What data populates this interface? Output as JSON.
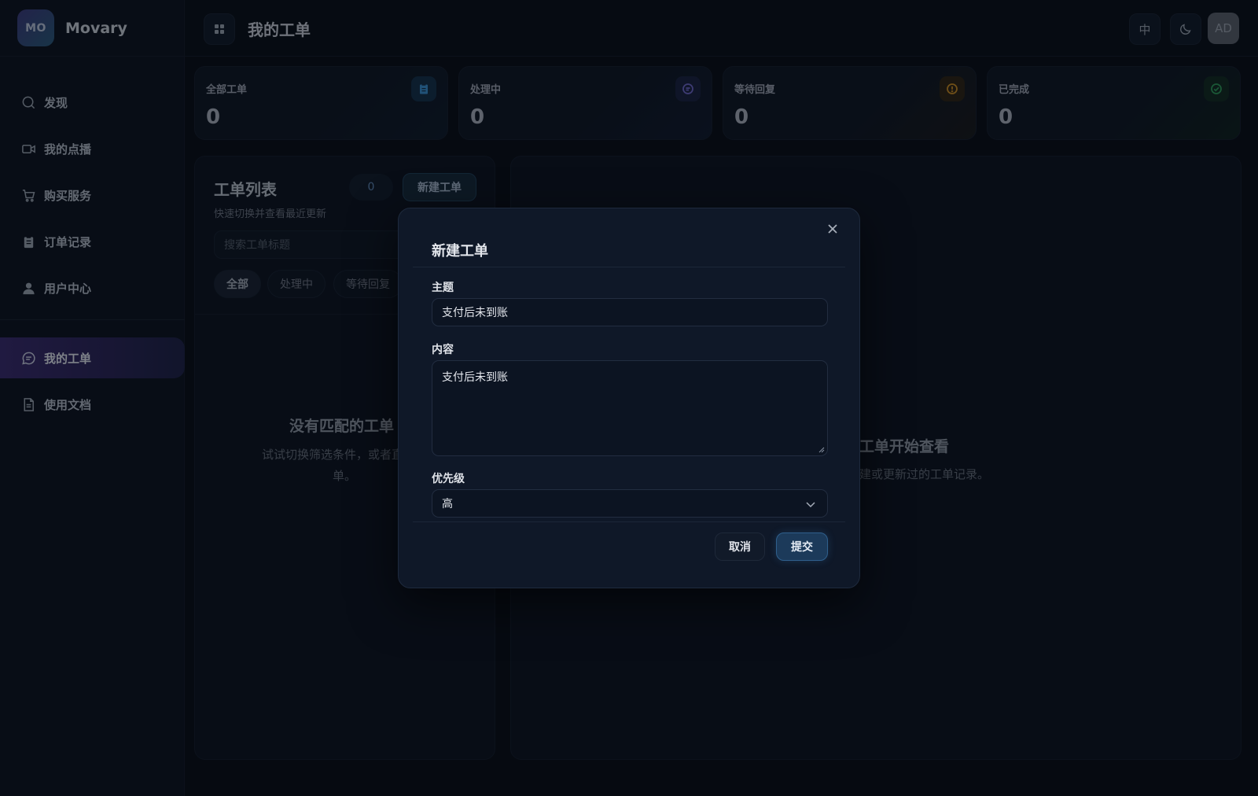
{
  "brand": {
    "logo_text": "MO",
    "name": "Movary"
  },
  "sidebar": {
    "items": [
      {
        "label": "发现",
        "icon": "search-icon"
      },
      {
        "label": "我的点播",
        "icon": "video-icon"
      },
      {
        "label": "购买服务",
        "icon": "cart-icon"
      },
      {
        "label": "订单记录",
        "icon": "clipboard-icon"
      },
      {
        "label": "用户中心",
        "icon": "user-icon"
      }
    ],
    "secondary": [
      {
        "label": "我的工单",
        "icon": "chat-icon",
        "active": true
      },
      {
        "label": "使用文档",
        "icon": "document-icon"
      }
    ]
  },
  "topbar": {
    "title": "我的工单",
    "lang_label": "中",
    "avatar_text": "AD"
  },
  "stats": [
    {
      "label": "全部工单",
      "value": "0",
      "icon": "clipboard-icon",
      "color": "#3a8ed0"
    },
    {
      "label": "处理中",
      "value": "0",
      "icon": "chat-icon",
      "color": "#6d67c8"
    },
    {
      "label": "等待回复",
      "value": "0",
      "icon": "alert-icon",
      "color": "#c98a23"
    },
    {
      "label": "已完成",
      "value": "0",
      "icon": "check-icon",
      "color": "#2f9a59"
    }
  ],
  "ticket_list": {
    "title": "工单列表",
    "subtitle": "快速切换并查看最近更新",
    "count": "0",
    "new_button": "新建工单",
    "search_placeholder": "搜索工单标题",
    "filters": [
      "全部",
      "处理中",
      "等待回复"
    ],
    "empty_title": "没有匹配的工单",
    "empty_desc_line1": "试试切换筛选条件，或者直接新",
    "empty_desc_line2": "单。"
  },
  "detail_panel": {
    "empty_title": "工单开始查看",
    "empty_desc": "建或更新过的工单记录。"
  },
  "modal": {
    "title": "新建工单",
    "subject_label": "主题",
    "subject_value": "支付后未到账",
    "content_label": "内容",
    "content_value": "支付后未到账",
    "priority_label": "优先级",
    "priority_value": "高",
    "cancel_label": "取消",
    "submit_label": "提交"
  }
}
